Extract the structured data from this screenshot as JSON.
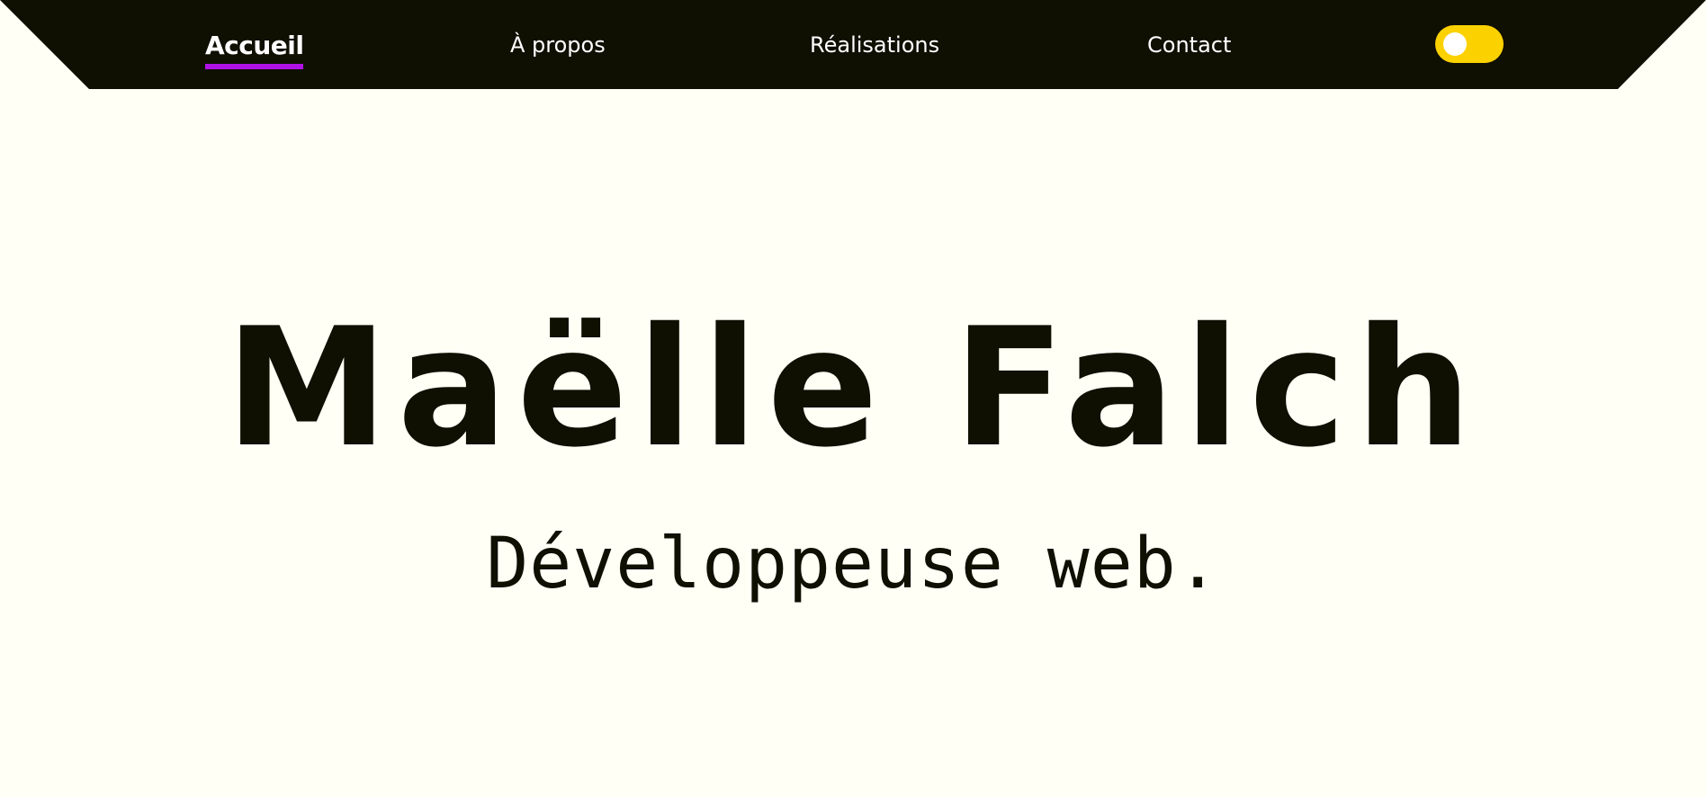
{
  "nav": {
    "items": [
      {
        "label": "Accueil",
        "active": true
      },
      {
        "label": "À propos",
        "active": false
      },
      {
        "label": "Réalisations",
        "active": false
      },
      {
        "label": "Contact",
        "active": false
      }
    ],
    "theme_toggle": {
      "state": "off"
    }
  },
  "hero": {
    "title": "Maëlle Falch",
    "subtitle": "Développeuse web."
  },
  "colors": {
    "background": "#fffff5",
    "navbar": "#0f0f02",
    "active_underline": "#b012e6",
    "toggle": "#fbd100",
    "text": "#0f0f02"
  }
}
